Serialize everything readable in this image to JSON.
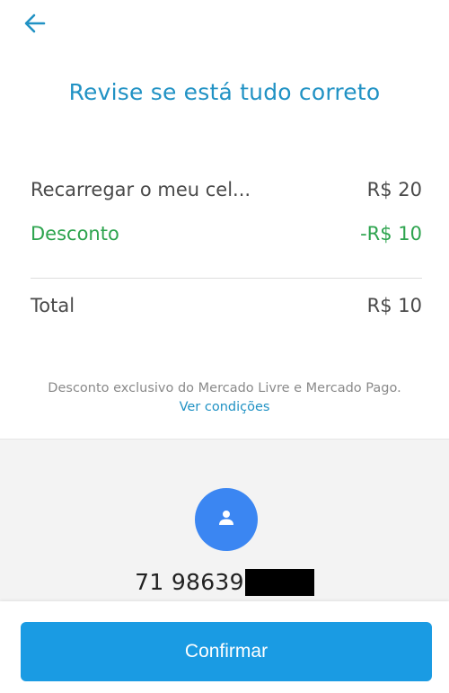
{
  "header": {
    "back_icon": "arrow-left-icon",
    "title": "Revise se está tudo correto"
  },
  "summary": {
    "item_label": "Recarregar o meu cel...",
    "item_value": "R$ 20",
    "discount_label": "Desconto",
    "discount_value": "-R$ 10",
    "total_label": "Total",
    "total_value": "R$ 10"
  },
  "disclaimer": {
    "text": "Desconto exclusivo do Mercado Livre e Mercado Pago.",
    "link": "Ver condições"
  },
  "phone": {
    "avatar_icon": "person-icon",
    "number": "71 98639"
  },
  "footer": {
    "confirm_label": "Confirmar"
  },
  "colors": {
    "accent": "#2192c4",
    "discount": "#2ea44f",
    "button": "#1a9be3",
    "avatar": "#3b86f2"
  }
}
